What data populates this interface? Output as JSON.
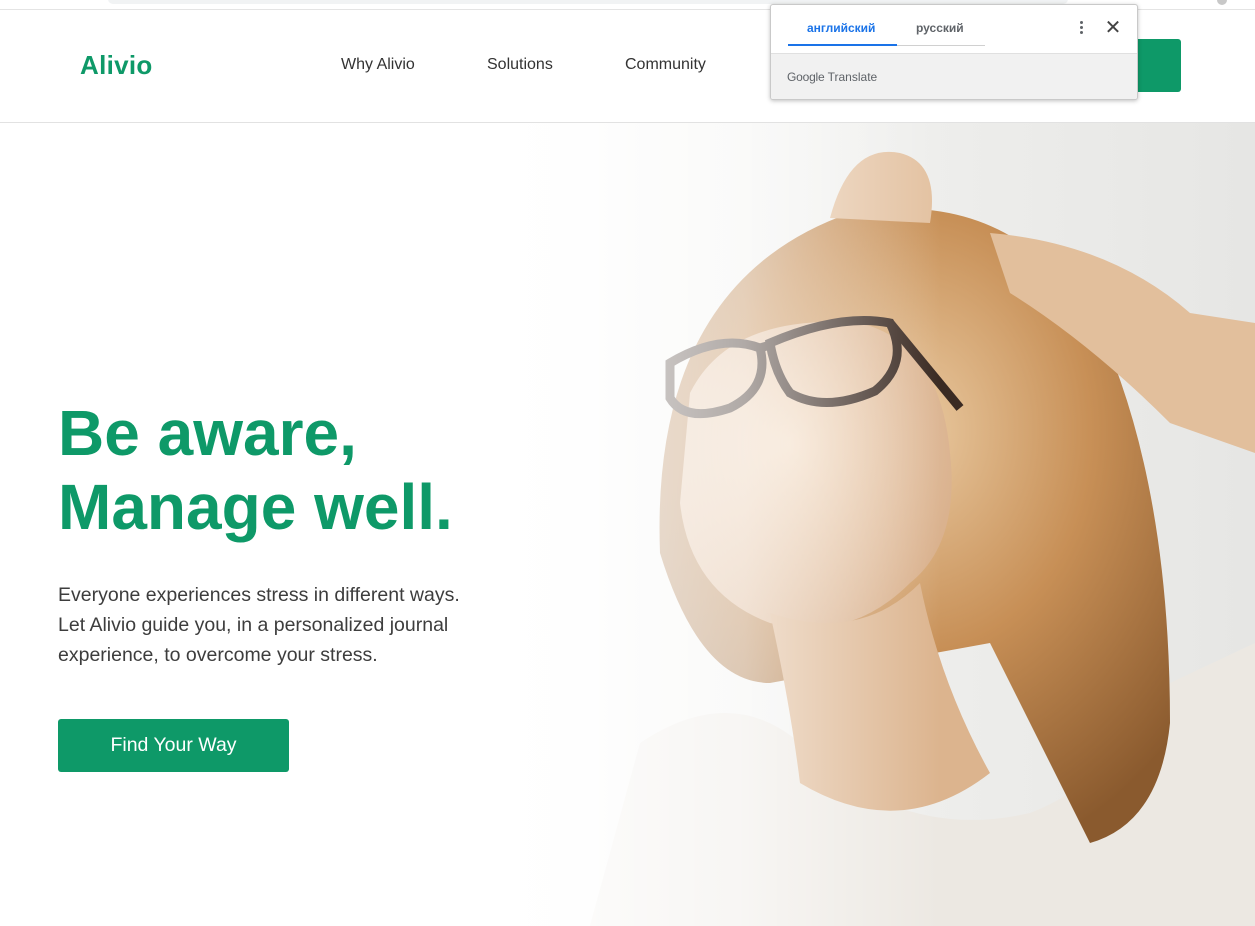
{
  "colors": {
    "brand": "#0e9968",
    "text": "#333333",
    "link_blue": "#1a73e8"
  },
  "header": {
    "logo": "Alivio",
    "nav": [
      {
        "label": "Why Alivio"
      },
      {
        "label": "Solutions"
      },
      {
        "label": "Community"
      }
    ]
  },
  "hero": {
    "title_line1": "Be aware,",
    "title_line2": "Manage well.",
    "subtitle": "Everyone experiences stress in different ways. Let Alivio guide you, in a personalized journal experience, to overcome your stress.",
    "cta_label": "Find Your Way",
    "image_icon": "woman-relaxing-photo"
  },
  "translate_popup": {
    "tabs": [
      {
        "label": "английский",
        "active": true
      },
      {
        "label": "русский",
        "active": false
      }
    ],
    "brand_google": "Google",
    "brand_translate": "Translate",
    "more_icon": "more-vert-icon",
    "close_icon": "close-icon"
  }
}
